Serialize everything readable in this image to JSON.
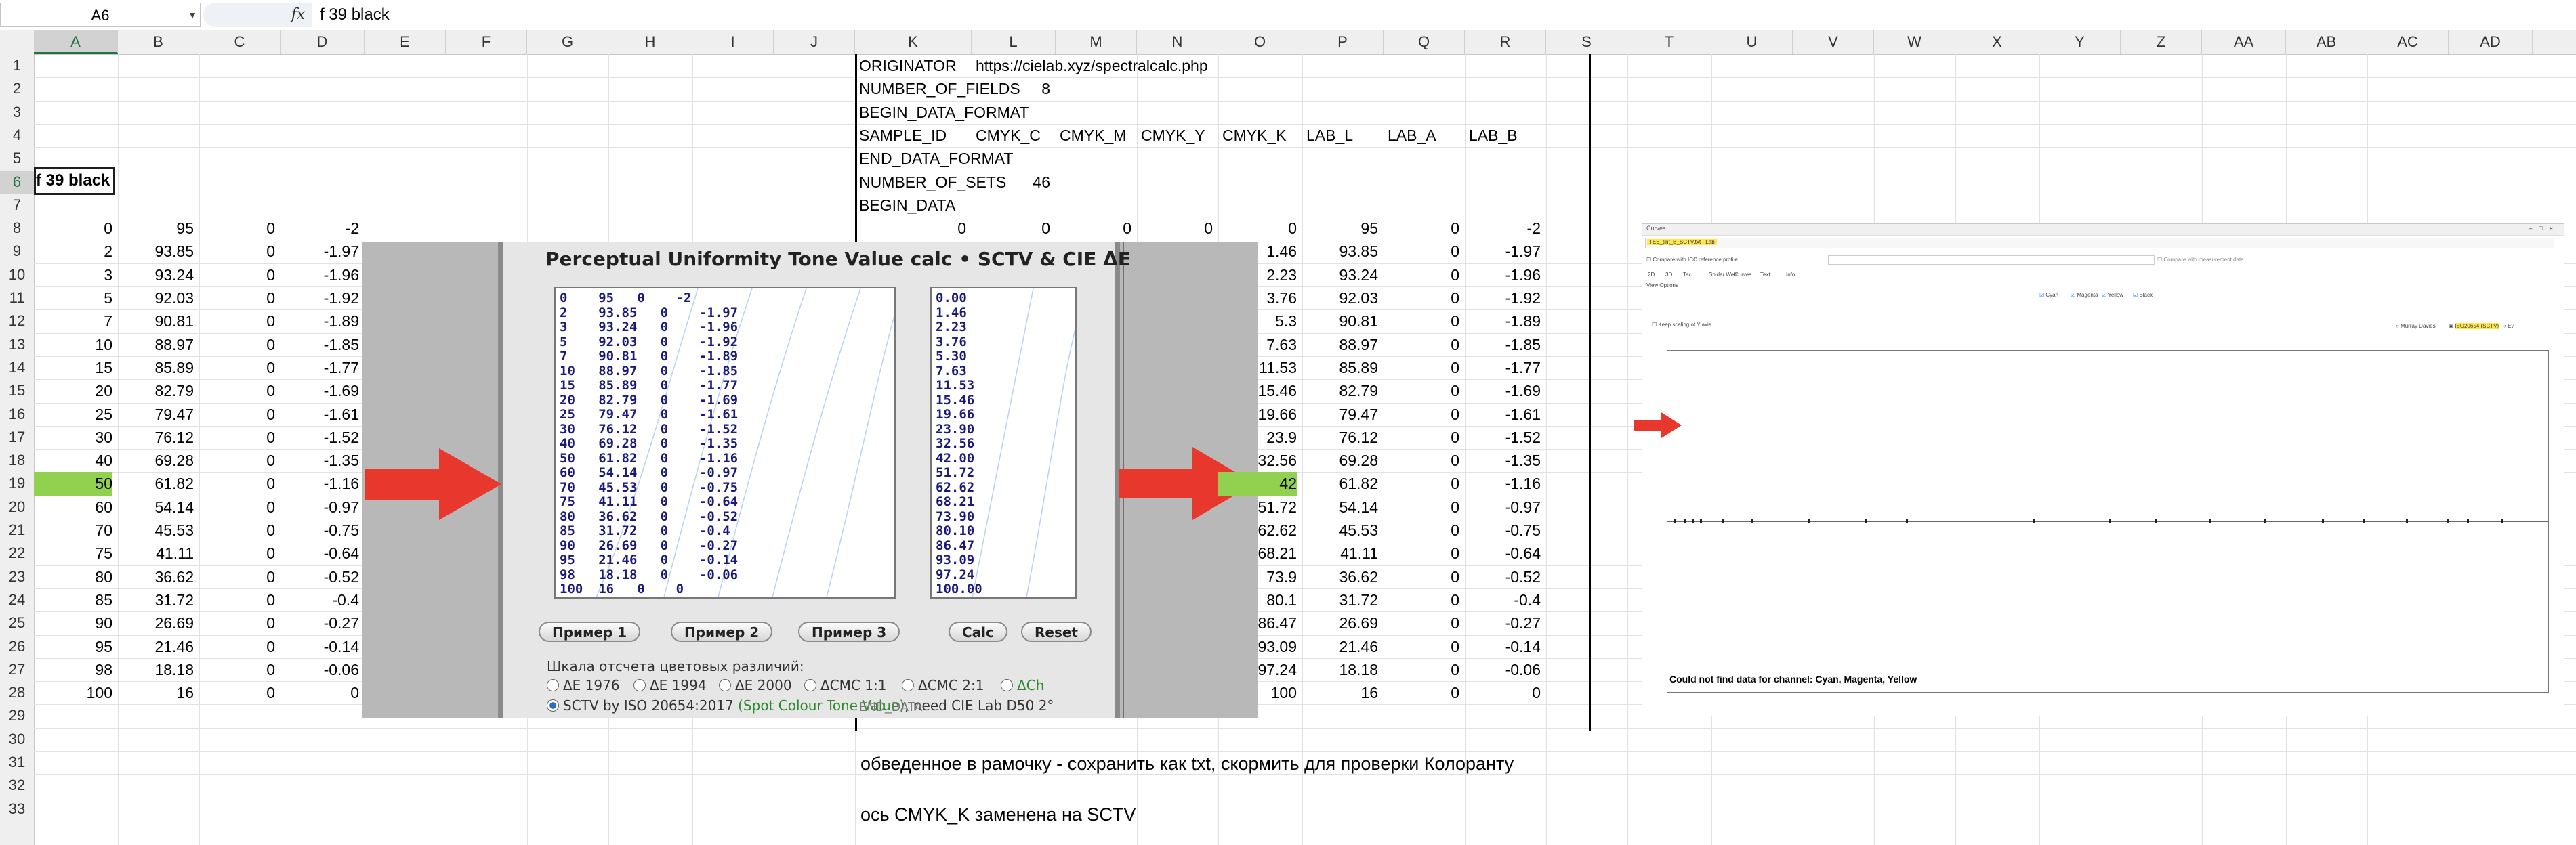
{
  "formula_bar": {
    "name_box": "A6",
    "fx_label": "fx",
    "formula": "f 39 black"
  },
  "columns": [
    "A",
    "B",
    "C",
    "D",
    "E",
    "F",
    "G",
    "H",
    "I",
    "J",
    "K",
    "L",
    "M",
    "N",
    "O",
    "P",
    "Q",
    "R",
    "S",
    "T",
    "U",
    "V",
    "W",
    "X",
    "Y",
    "Z",
    "AA",
    "AB",
    "AC",
    "AD"
  ],
  "rows": [
    "1",
    "2",
    "3",
    "4",
    "5",
    "6",
    "7",
    "8",
    "9",
    "10",
    "11",
    "12",
    "13",
    "14",
    "15",
    "16",
    "17",
    "18",
    "19",
    "20",
    "21",
    "22",
    "23",
    "24",
    "25",
    "26",
    "27",
    "28",
    "29",
    "30",
    "31",
    "32",
    "33"
  ],
  "selected_cell_text": "f 39 black",
  "left_table": [
    [
      "0",
      "95",
      "0",
      "-2"
    ],
    [
      "2",
      "93.85",
      "0",
      "-1.97"
    ],
    [
      "3",
      "93.24",
      "0",
      "-1.96"
    ],
    [
      "5",
      "92.03",
      "0",
      "-1.92"
    ],
    [
      "7",
      "90.81",
      "0",
      "-1.89"
    ],
    [
      "10",
      "88.97",
      "0",
      "-1.85"
    ],
    [
      "15",
      "85.89",
      "0",
      "-1.77"
    ],
    [
      "20",
      "82.79",
      "0",
      "-1.69"
    ],
    [
      "25",
      "79.47",
      "0",
      "-1.61"
    ],
    [
      "30",
      "76.12",
      "0",
      "-1.52"
    ],
    [
      "40",
      "69.28",
      "0",
      "-1.35"
    ],
    [
      "50",
      "61.82",
      "0",
      "-1.16"
    ],
    [
      "60",
      "54.14",
      "0",
      "-0.97"
    ],
    [
      "70",
      "45.53",
      "0",
      "-0.75"
    ],
    [
      "75",
      "41.11",
      "0",
      "-0.64"
    ],
    [
      "80",
      "36.62",
      "0",
      "-0.52"
    ],
    [
      "85",
      "31.72",
      "0",
      "-0.4"
    ],
    [
      "90",
      "26.69",
      "0",
      "-0.27"
    ],
    [
      "95",
      "21.46",
      "0",
      "-0.14"
    ],
    [
      "98",
      "18.18",
      "0",
      "-0.06"
    ],
    [
      "100",
      "16",
      "0",
      "0"
    ]
  ],
  "cgats_header": {
    "r1": [
      "ORIGINATOR",
      "https://cielab.xyz/spectralcalc.php"
    ],
    "r2": [
      "NUMBER_OF_FIELDS",
      "8"
    ],
    "r3": [
      "BEGIN_DATA_FORMAT"
    ],
    "r4": [
      "SAMPLE_ID",
      "CMYK_C",
      "CMYK_M",
      "CMYK_Y",
      "CMYK_K",
      "LAB_L",
      "LAB_A",
      "LAB_B"
    ],
    "r5": [
      "END_DATA_FORMAT"
    ],
    "r6": [
      "NUMBER_OF_SETS",
      "46"
    ],
    "r7": [
      "BEGIN_DATA"
    ],
    "r8": [
      "0",
      "0",
      "0",
      "0",
      "0",
      "95",
      "0",
      "-2"
    ],
    "end": "END_DATA"
  },
  "right_table": [
    [
      "1.46",
      "93.85",
      "0",
      "-1.97"
    ],
    [
      "2.23",
      "93.24",
      "0",
      "-1.96"
    ],
    [
      "3.76",
      "92.03",
      "0",
      "-1.92"
    ],
    [
      "5.3",
      "90.81",
      "0",
      "-1.89"
    ],
    [
      "7.63",
      "88.97",
      "0",
      "-1.85"
    ],
    [
      "11.53",
      "85.89",
      "0",
      "-1.77"
    ],
    [
      "15.46",
      "82.79",
      "0",
      "-1.69"
    ],
    [
      "19.66",
      "79.47",
      "0",
      "-1.61"
    ],
    [
      "23.9",
      "76.12",
      "0",
      "-1.52"
    ],
    [
      "32.56",
      "69.28",
      "0",
      "-1.35"
    ],
    [
      "42",
      "61.82",
      "0",
      "-1.16"
    ],
    [
      "51.72",
      "54.14",
      "0",
      "-0.97"
    ],
    [
      "62.62",
      "45.53",
      "0",
      "-0.75"
    ],
    [
      "68.21",
      "41.11",
      "0",
      "-0.64"
    ],
    [
      "73.9",
      "36.62",
      "0",
      "-0.52"
    ],
    [
      "80.1",
      "31.72",
      "0",
      "-0.4"
    ],
    [
      "86.47",
      "26.69",
      "0",
      "-0.27"
    ],
    [
      "93.09",
      "21.46",
      "0",
      "-0.14"
    ],
    [
      "97.24",
      "18.18",
      "0",
      "-0.06"
    ],
    [
      "100",
      "16",
      "0",
      "0"
    ]
  ],
  "calculator": {
    "title": "Perceptual Uniformity Tone Value calc  •  SCTV & CIE ΔE",
    "input_text": "0    95   0    -2\n2    93.85   0    -1.97\n3    93.24   0    -1.96\n5    92.03   0    -1.92\n7    90.81   0    -1.89\n10   88.97   0    -1.85\n15   85.89   0    -1.77\n20   82.79   0    -1.69\n25   79.47   0    -1.61\n30   76.12   0    -1.52\n40   69.28   0    -1.35\n50   61.82   0    -1.16\n60   54.14   0    -0.97\n70   45.53   0    -0.75\n75   41.11   0    -0.64\n80   36.62   0    -0.52\n85   31.72   0    -0.4\n90   26.69   0    -0.27\n95   21.46   0    -0.14\n98   18.18   0    -0.06\n100  16   0    0",
    "output_text": "0.00\n1.46\n2.23\n3.76\n5.30\n7.63\n11.53\n15.46\n19.66\n23.90\n32.56\n42.00\n51.72\n62.62\n68.21\n73.90\n80.10\n86.47\n93.09\n97.24\n100.00",
    "buttons": {
      "example1": "Пример 1",
      "example2": "Пример 2",
      "example3": "Пример 3",
      "calc": "Calc",
      "reset": "Reset"
    },
    "scale_label": "Шкала отсчета цветовых различий:",
    "options": [
      "ΔE 1976",
      "ΔE 1994",
      "ΔE 2000",
      "ΔCMC 1:1",
      "ΔCMC 2:1",
      "ΔCh"
    ],
    "sctv_option": {
      "prefix": "SCTV by ISO 20654:2017 ",
      "green": "(Spot Colour Tone Value)",
      "suffix": ", need CIE Lab D50 2°"
    },
    "selected_option": "sctv"
  },
  "embedded_app": {
    "window_title": "Curves",
    "file_label": "TEE_tint_B_SCTV.txt - Lab",
    "compare_icc": "Compare with ICC reference profile",
    "compare_meas": "Compare with measurement data",
    "tabs": [
      "2D",
      "3D",
      "Tac",
      "Spider Web",
      "Curves",
      "Text",
      "Info"
    ],
    "view_options": "View Options",
    "channels": [
      "Cyan",
      "Magenta",
      "Yellow",
      "Black"
    ],
    "keep_scaling": "Keep scaling of Y axis",
    "scale_options": [
      "Murray Davies",
      "ISO20654 (SCTV)",
      "E?"
    ],
    "message": "Could not find data for channel: Cyan, Magenta, Yellow",
    "highlight_color": "#ffe94a"
  },
  "notes": {
    "note1": "обведенное в рамочку - сохранить как txt, скормить для проверки Колоранту",
    "note2": "ось CMYK_K заменена на SCTV"
  },
  "colors": {
    "highlight_green": "#92d050",
    "arrow_red": "#e8372d",
    "excel_green": "#217346"
  }
}
